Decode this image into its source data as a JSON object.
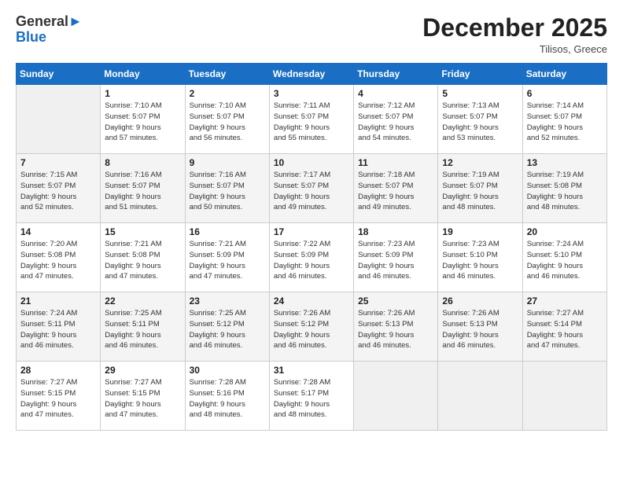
{
  "header": {
    "logo_line1": "General",
    "logo_line2": "Blue",
    "month": "December 2025",
    "location": "Tilisos, Greece"
  },
  "weekdays": [
    "Sunday",
    "Monday",
    "Tuesday",
    "Wednesday",
    "Thursday",
    "Friday",
    "Saturday"
  ],
  "weeks": [
    [
      {
        "day": "",
        "info": ""
      },
      {
        "day": "1",
        "info": "Sunrise: 7:10 AM\nSunset: 5:07 PM\nDaylight: 9 hours\nand 57 minutes."
      },
      {
        "day": "2",
        "info": "Sunrise: 7:10 AM\nSunset: 5:07 PM\nDaylight: 9 hours\nand 56 minutes."
      },
      {
        "day": "3",
        "info": "Sunrise: 7:11 AM\nSunset: 5:07 PM\nDaylight: 9 hours\nand 55 minutes."
      },
      {
        "day": "4",
        "info": "Sunrise: 7:12 AM\nSunset: 5:07 PM\nDaylight: 9 hours\nand 54 minutes."
      },
      {
        "day": "5",
        "info": "Sunrise: 7:13 AM\nSunset: 5:07 PM\nDaylight: 9 hours\nand 53 minutes."
      },
      {
        "day": "6",
        "info": "Sunrise: 7:14 AM\nSunset: 5:07 PM\nDaylight: 9 hours\nand 52 minutes."
      }
    ],
    [
      {
        "day": "7",
        "info": "Sunrise: 7:15 AM\nSunset: 5:07 PM\nDaylight: 9 hours\nand 52 minutes."
      },
      {
        "day": "8",
        "info": "Sunrise: 7:16 AM\nSunset: 5:07 PM\nDaylight: 9 hours\nand 51 minutes."
      },
      {
        "day": "9",
        "info": "Sunrise: 7:16 AM\nSunset: 5:07 PM\nDaylight: 9 hours\nand 50 minutes."
      },
      {
        "day": "10",
        "info": "Sunrise: 7:17 AM\nSunset: 5:07 PM\nDaylight: 9 hours\nand 49 minutes."
      },
      {
        "day": "11",
        "info": "Sunrise: 7:18 AM\nSunset: 5:07 PM\nDaylight: 9 hours\nand 49 minutes."
      },
      {
        "day": "12",
        "info": "Sunrise: 7:19 AM\nSunset: 5:07 PM\nDaylight: 9 hours\nand 48 minutes."
      },
      {
        "day": "13",
        "info": "Sunrise: 7:19 AM\nSunset: 5:08 PM\nDaylight: 9 hours\nand 48 minutes."
      }
    ],
    [
      {
        "day": "14",
        "info": "Sunrise: 7:20 AM\nSunset: 5:08 PM\nDaylight: 9 hours\nand 47 minutes."
      },
      {
        "day": "15",
        "info": "Sunrise: 7:21 AM\nSunset: 5:08 PM\nDaylight: 9 hours\nand 47 minutes."
      },
      {
        "day": "16",
        "info": "Sunrise: 7:21 AM\nSunset: 5:09 PM\nDaylight: 9 hours\nand 47 minutes."
      },
      {
        "day": "17",
        "info": "Sunrise: 7:22 AM\nSunset: 5:09 PM\nDaylight: 9 hours\nand 46 minutes."
      },
      {
        "day": "18",
        "info": "Sunrise: 7:23 AM\nSunset: 5:09 PM\nDaylight: 9 hours\nand 46 minutes."
      },
      {
        "day": "19",
        "info": "Sunrise: 7:23 AM\nSunset: 5:10 PM\nDaylight: 9 hours\nand 46 minutes."
      },
      {
        "day": "20",
        "info": "Sunrise: 7:24 AM\nSunset: 5:10 PM\nDaylight: 9 hours\nand 46 minutes."
      }
    ],
    [
      {
        "day": "21",
        "info": "Sunrise: 7:24 AM\nSunset: 5:11 PM\nDaylight: 9 hours\nand 46 minutes."
      },
      {
        "day": "22",
        "info": "Sunrise: 7:25 AM\nSunset: 5:11 PM\nDaylight: 9 hours\nand 46 minutes."
      },
      {
        "day": "23",
        "info": "Sunrise: 7:25 AM\nSunset: 5:12 PM\nDaylight: 9 hours\nand 46 minutes."
      },
      {
        "day": "24",
        "info": "Sunrise: 7:26 AM\nSunset: 5:12 PM\nDaylight: 9 hours\nand 46 minutes."
      },
      {
        "day": "25",
        "info": "Sunrise: 7:26 AM\nSunset: 5:13 PM\nDaylight: 9 hours\nand 46 minutes."
      },
      {
        "day": "26",
        "info": "Sunrise: 7:26 AM\nSunset: 5:13 PM\nDaylight: 9 hours\nand 46 minutes."
      },
      {
        "day": "27",
        "info": "Sunrise: 7:27 AM\nSunset: 5:14 PM\nDaylight: 9 hours\nand 47 minutes."
      }
    ],
    [
      {
        "day": "28",
        "info": "Sunrise: 7:27 AM\nSunset: 5:15 PM\nDaylight: 9 hours\nand 47 minutes."
      },
      {
        "day": "29",
        "info": "Sunrise: 7:27 AM\nSunset: 5:15 PM\nDaylight: 9 hours\nand 47 minutes."
      },
      {
        "day": "30",
        "info": "Sunrise: 7:28 AM\nSunset: 5:16 PM\nDaylight: 9 hours\nand 48 minutes."
      },
      {
        "day": "31",
        "info": "Sunrise: 7:28 AM\nSunset: 5:17 PM\nDaylight: 9 hours\nand 48 minutes."
      },
      {
        "day": "",
        "info": ""
      },
      {
        "day": "",
        "info": ""
      },
      {
        "day": "",
        "info": ""
      }
    ]
  ]
}
